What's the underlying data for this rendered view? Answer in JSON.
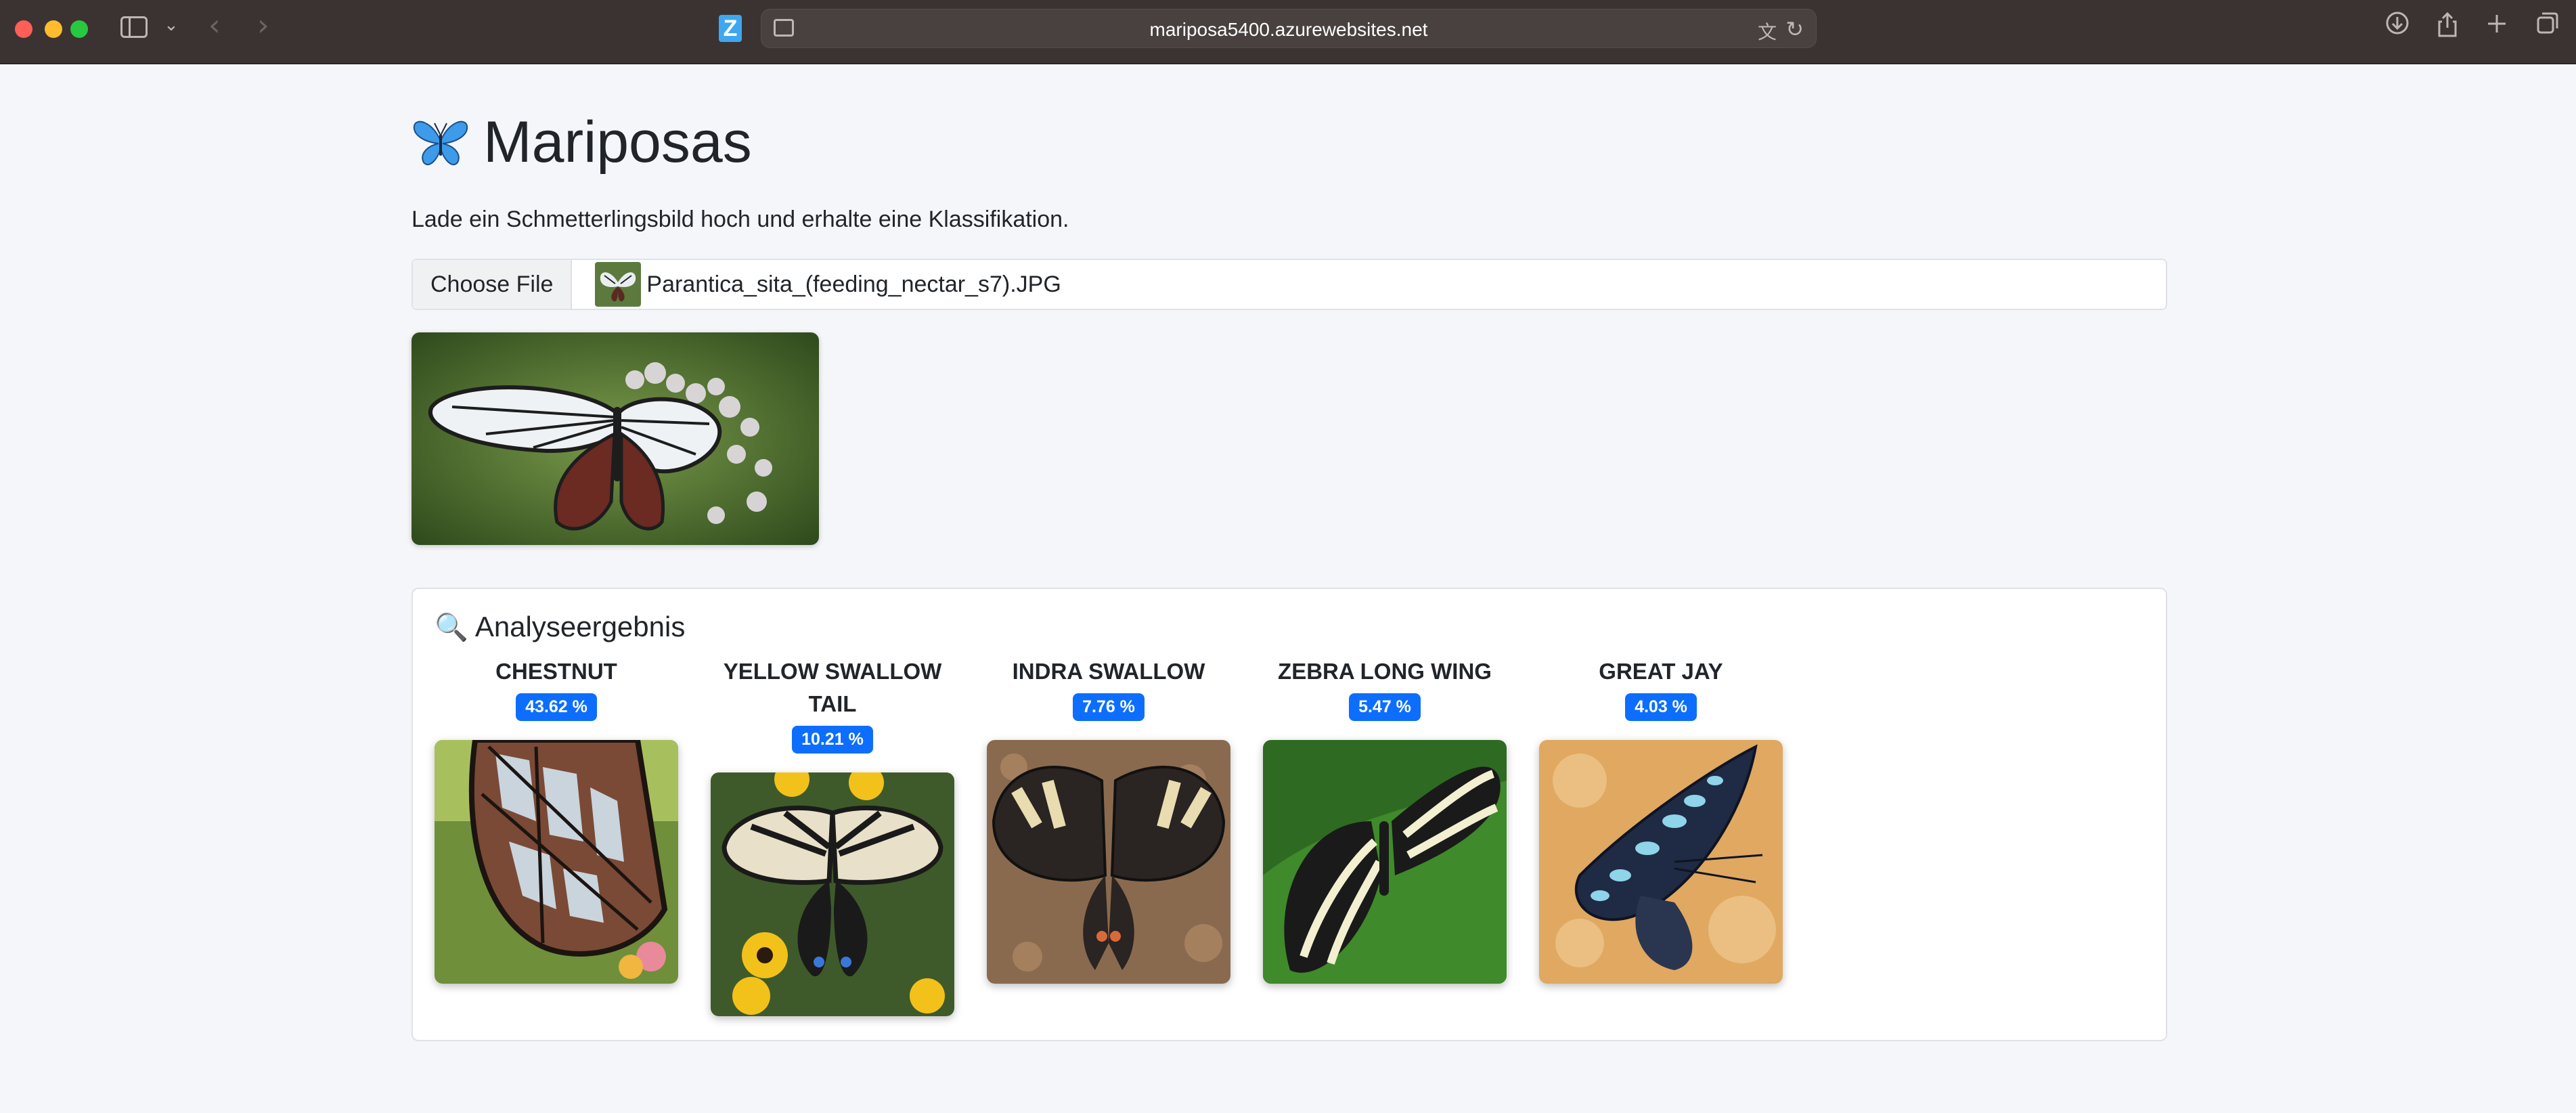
{
  "browser": {
    "url": "mariposa5400.azurewebsites.net",
    "icons": [
      "sidebar-icon",
      "chevron-down-icon",
      "back-arrow-icon",
      "forward-arrow-icon",
      "zotero-icon",
      "page-icon",
      "translate-icon",
      "reload-icon",
      "download-icon",
      "share-icon",
      "new-tab-icon",
      "tab-overview-icon"
    ]
  },
  "page": {
    "title": "Mariposas",
    "title_icon": "butterfly-icon",
    "subtitle": "Lade ein Schmetterlingsbild hoch und erhalte eine Klassifikation.",
    "file_input": {
      "button_label": "Choose File",
      "file_name": "Parantica_sita_(feeding_nectar_s7).JPG"
    },
    "result": {
      "heading_icon": "magnifier-icon",
      "heading": "Analyseergebnis",
      "predictions": [
        {
          "name": "CHESTNUT",
          "percent": "43.62 %",
          "color": "#7a4a36"
        },
        {
          "name": "YELLOW SWALLOW TAIL",
          "percent": "10.21 %",
          "color": "#e8e0c8"
        },
        {
          "name": "INDRA SWALLOW",
          "percent": "7.76 %",
          "color": "#2a2422"
        },
        {
          "name": "ZEBRA LONG WING",
          "percent": "5.47 %",
          "color": "#1a1a1a"
        },
        {
          "name": "GREAT JAY",
          "percent": "4.03 %",
          "color": "#1f2a44"
        }
      ]
    }
  },
  "colors": {
    "badge": "#0d6efd",
    "chrome": "#3b3331",
    "page_bg": "#f4f6f9"
  }
}
